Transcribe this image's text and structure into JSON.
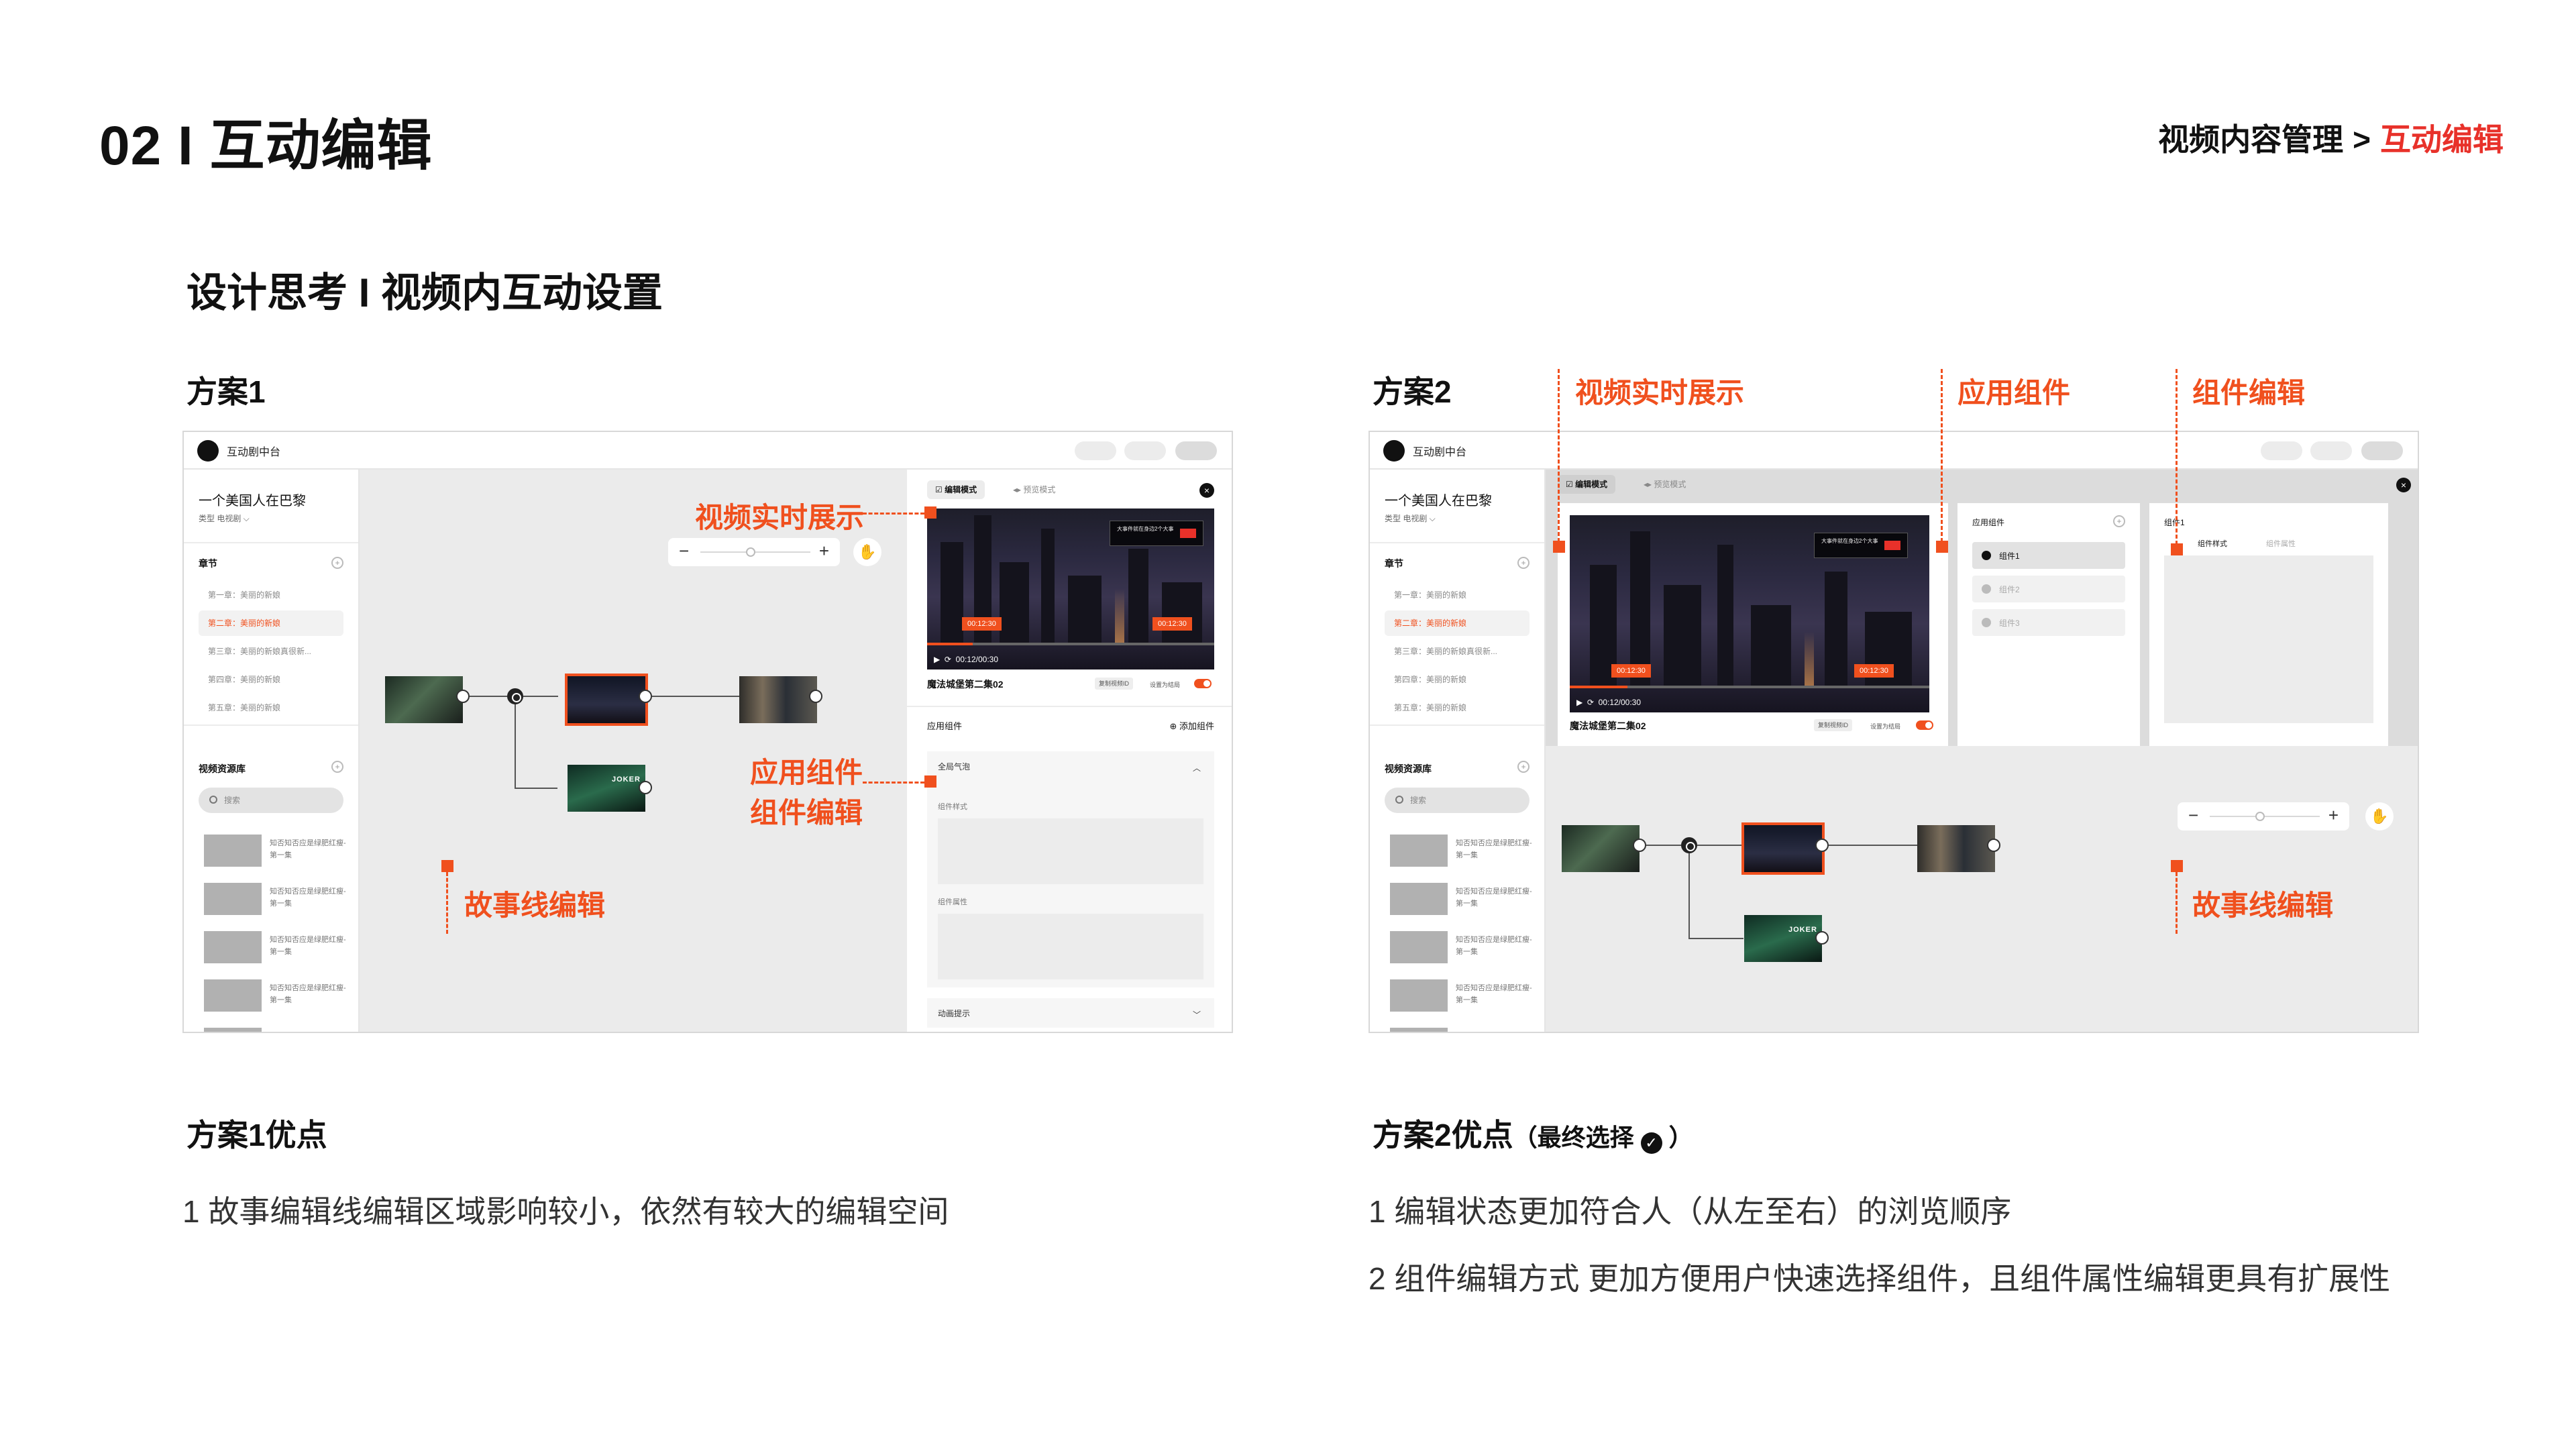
{
  "header": {
    "title": "02 I 互动编辑",
    "breadcrumb": {
      "parent": "视频内容管理",
      "separator": ">",
      "current": "互动编辑"
    }
  },
  "subtitle": "设计思考 I 视频内互动设置",
  "colors": {
    "accent": "#f0501e",
    "breadcrumb_active": "#e8312a",
    "text": "#111111"
  },
  "mock": {
    "app_title": "互动剧中台",
    "show_title": "一个美国人在巴黎",
    "show_meta": "类型 电视剧 ⌵",
    "chapters_label": "章节",
    "chapters": [
      "第一章：美丽的新娘",
      "第二章：美丽的新娘",
      "第三章：美丽的新娘真很新...",
      "第四章：美丽的新娘",
      "第五章：美丽的新娘"
    ],
    "selected_chapter": 1,
    "library_label": "视频资源库",
    "search_placeholder": "搜索",
    "resource_text": "知否知否应是绿肥红瘦-第一集",
    "tabs": {
      "edit": "编辑模式",
      "preview": "预览模式"
    },
    "video": {
      "ad_text": "大事件就在身边2个大事",
      "badge_left": "00:12:30",
      "badge_right": "00:12:30",
      "time": "00:12/00:30",
      "title": "魔法城堡第二集02",
      "copy_button": "复制视频ID",
      "toggle_label": "设置为结局"
    },
    "graph_thumb_text": "JOKER",
    "icons": {
      "play": "play-icon",
      "replay": "replay-icon",
      "hand": "hand-icon",
      "close": "close-icon",
      "search": "search-icon",
      "add": "add-icon",
      "chevron": "chevron-icon"
    }
  },
  "plan1": {
    "label": "方案1",
    "components_title": "应用组件",
    "add_component": "添加组件",
    "accordion_open": "全局气泡",
    "field_style": "组件样式",
    "field_props": "组件属性",
    "accordion_closed": "动画提示",
    "annotations": {
      "video": "视频实时展示",
      "component_apply": "应用组件",
      "component_edit": "组件编辑",
      "storyline": "故事线编辑"
    },
    "advantages_title": "方案1优点",
    "advantages": [
      "1  故事编辑线编辑区域影响较小，依然有较大的编辑空间"
    ]
  },
  "plan2": {
    "label": "方案2",
    "components_title": "应用组件",
    "components": [
      "组件1",
      "组件2",
      "组件3"
    ],
    "edit_title": "组件1",
    "edit_tabs": [
      "组件样式",
      "组件属性"
    ],
    "annotations": {
      "video": "视频实时展示",
      "component_apply": "应用组件",
      "component_edit": "组件编辑",
      "storyline": "故事线编辑"
    },
    "advantages_title": "方案2优点",
    "advantages_note": "（最终选择",
    "advantages_note_end": "）",
    "advantages": [
      "1 编辑状态更加符合人（从左至右）的浏览顺序",
      "2 组件编辑方式 更加方便用户快速选择组件，且组件属性编辑更具有扩展性"
    ]
  }
}
